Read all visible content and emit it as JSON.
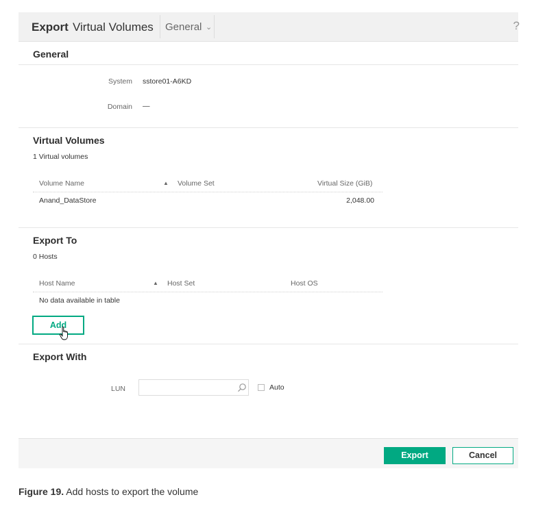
{
  "header": {
    "action": "Export",
    "object": "Virtual Volumes",
    "view": "General",
    "help": "?"
  },
  "general": {
    "title": "General",
    "system_label": "System",
    "system_value": "sstore01-A6KD",
    "domain_label": "Domain",
    "domain_value": "—"
  },
  "virtual_volumes": {
    "title": "Virtual Volumes",
    "count": "1 Virtual volumes",
    "columns": [
      "Volume Name",
      "Volume Set",
      "Virtual Size (GiB)"
    ],
    "rows": [
      {
        "name": "Anand_DataStore",
        "set": "",
        "size": "2,048.00"
      }
    ]
  },
  "export_to": {
    "title": "Export To",
    "count": "0 Hosts",
    "columns": [
      "Host Name",
      "Host Set",
      "Host OS"
    ],
    "empty": "No data available in table",
    "add_label": "Add"
  },
  "export_with": {
    "title": "Export With",
    "lun_label": "LUN",
    "lun_value": "",
    "auto_label": "Auto",
    "auto_checked": false
  },
  "footer": {
    "export_label": "Export",
    "cancel_label": "Cancel"
  },
  "caption": {
    "figure": "Figure 19.",
    "text": "Add hosts to export the volume"
  },
  "colors": {
    "accent": "#01a982",
    "header_bg": "#f1f1f1",
    "footer_bg": "#f5f5f5"
  },
  "icons": {
    "view_dropdown": "chevron-down-icon",
    "sort_ascending": "sort-ascending-icon",
    "lun_search": "search-icon",
    "cursor": "hand-pointer-icon"
  }
}
